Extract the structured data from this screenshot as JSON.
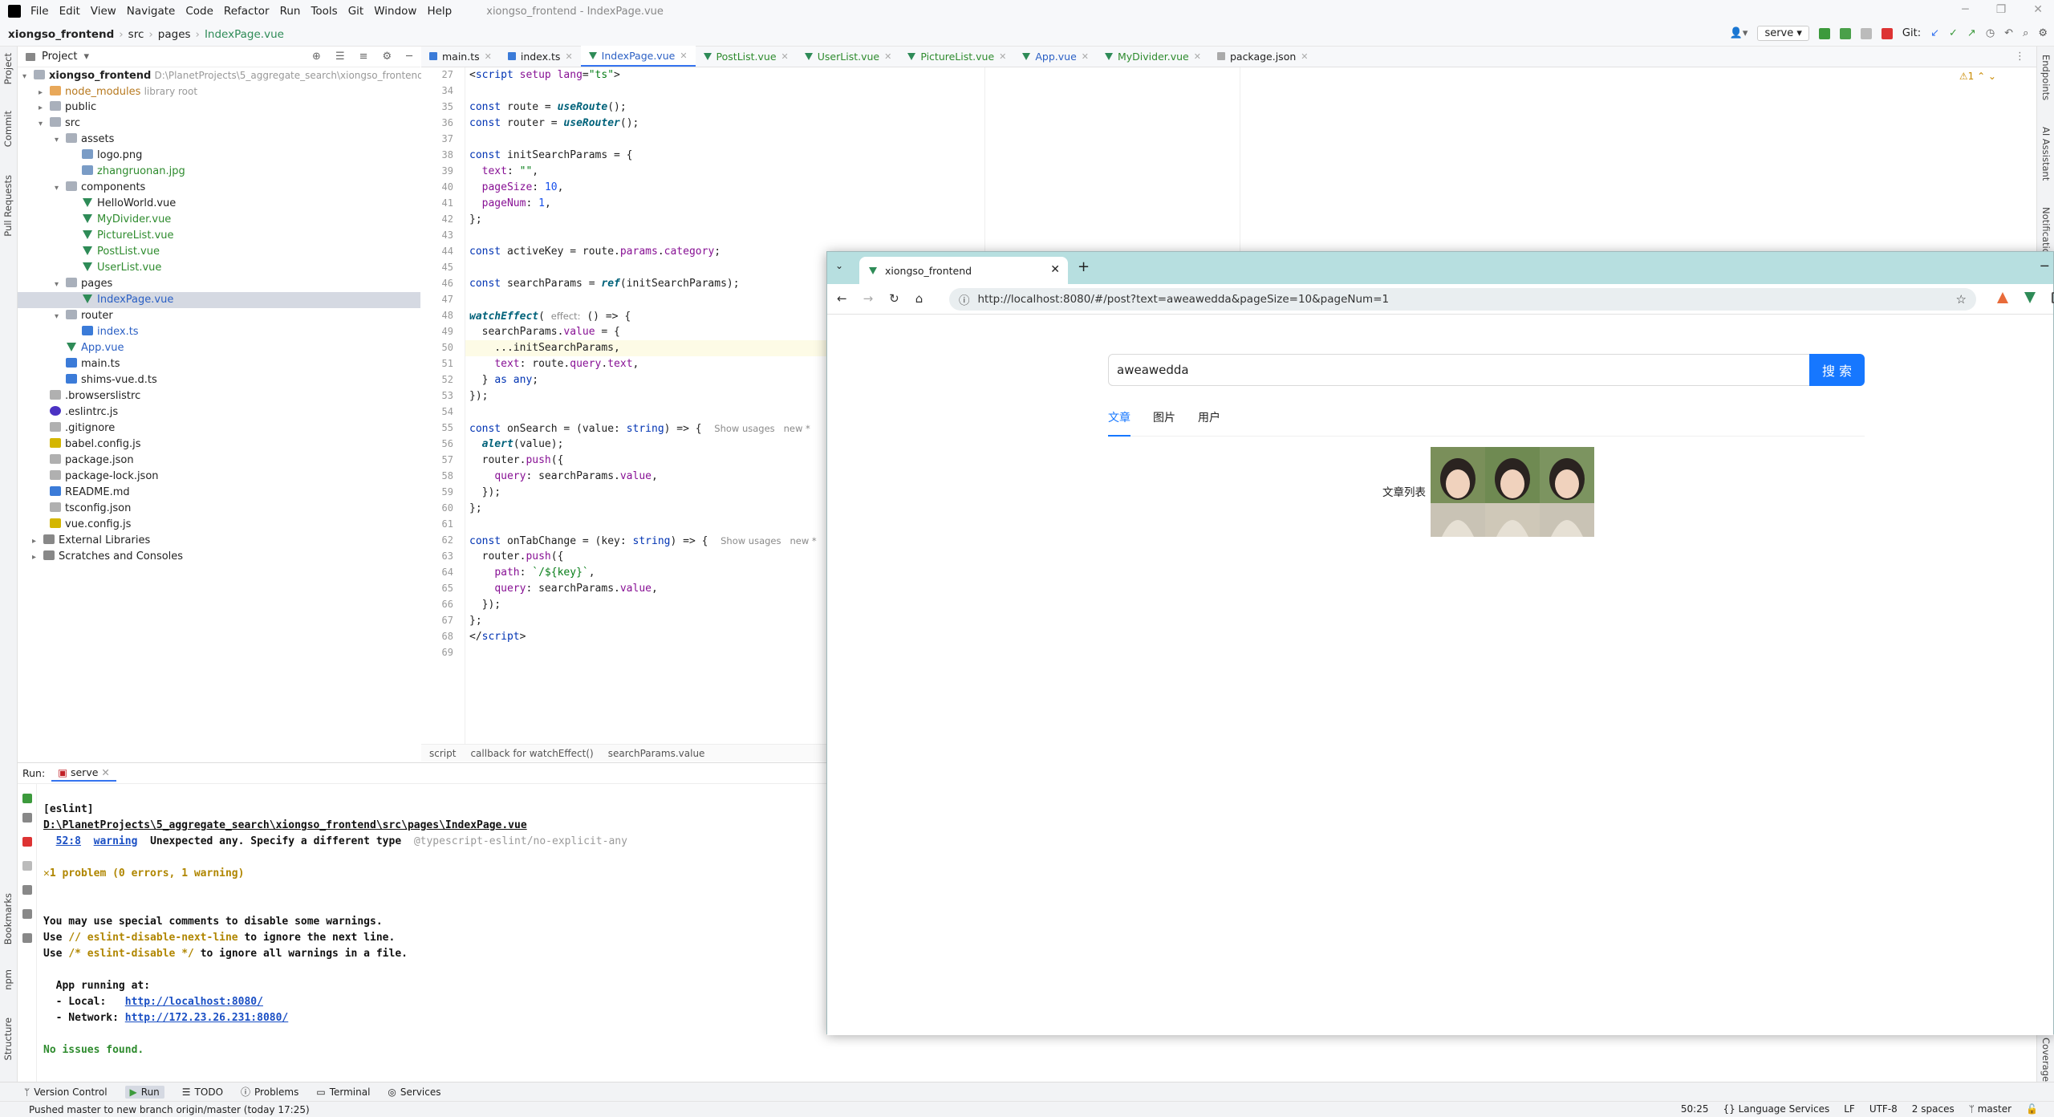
{
  "menubar": {
    "items": [
      "File",
      "Edit",
      "View",
      "Navigate",
      "Code",
      "Refactor",
      "Run",
      "Tools",
      "Git",
      "Window",
      "Help"
    ],
    "window_title": "xiongso_frontend - IndexPage.vue"
  },
  "navbar": {
    "project": "xiongso_frontend",
    "path": [
      "src",
      "pages"
    ],
    "file": "IndexPage.vue",
    "run_config": "serve",
    "git_label": "Git:"
  },
  "project_panel": {
    "title": "Project",
    "rows": [
      {
        "label": "xiongso_frontend",
        "extra": "D:\\PlanetProjects\\5_aggregate_search\\xiongso_frontend"
      },
      {
        "label": "node_modules",
        "extra": "library root"
      },
      {
        "label": "public",
        "extra": ""
      },
      {
        "label": "src",
        "extra": ""
      },
      {
        "label": "assets",
        "extra": ""
      },
      {
        "label": "logo.png",
        "extra": ""
      },
      {
        "label": "zhangruonan.jpg",
        "extra": ""
      },
      {
        "label": "components",
        "extra": ""
      },
      {
        "label": "HelloWorld.vue",
        "extra": ""
      },
      {
        "label": "MyDivider.vue",
        "extra": ""
      },
      {
        "label": "PictureList.vue",
        "extra": ""
      },
      {
        "label": "PostList.vue",
        "extra": ""
      },
      {
        "label": "UserList.vue",
        "extra": ""
      },
      {
        "label": "pages",
        "extra": ""
      },
      {
        "label": "IndexPage.vue",
        "extra": ""
      },
      {
        "label": "router",
        "extra": ""
      },
      {
        "label": "index.ts",
        "extra": ""
      },
      {
        "label": "App.vue",
        "extra": ""
      },
      {
        "label": "main.ts",
        "extra": ""
      },
      {
        "label": "shims-vue.d.ts",
        "extra": ""
      },
      {
        "label": ".browserslistrc",
        "extra": ""
      },
      {
        "label": ".eslintrc.js",
        "extra": ""
      },
      {
        "label": ".gitignore",
        "extra": ""
      },
      {
        "label": "babel.config.js",
        "extra": ""
      },
      {
        "label": "package.json",
        "extra": ""
      },
      {
        "label": "package-lock.json",
        "extra": ""
      },
      {
        "label": "README.md",
        "extra": ""
      },
      {
        "label": "tsconfig.json",
        "extra": ""
      },
      {
        "label": "vue.config.js",
        "extra": ""
      },
      {
        "label": "External Libraries",
        "extra": ""
      },
      {
        "label": "Scratches and Consoles",
        "extra": ""
      }
    ]
  },
  "editor_tabs": [
    "main.ts",
    "index.ts",
    "IndexPage.vue",
    "PostList.vue",
    "UserList.vue",
    "PictureList.vue",
    "App.vue",
    "MyDivider.vue",
    "package.json"
  ],
  "editor": {
    "line_numbers": [
      "27",
      "34",
      "35",
      "36",
      "37",
      "38",
      "39",
      "40",
      "41",
      "42",
      "43",
      "44",
      "45",
      "46",
      "47",
      "48",
      "49",
      "50",
      "51",
      "52",
      "53",
      "54",
      "55",
      "56",
      "57",
      "58",
      "59",
      "60",
      "61",
      "62",
      "63",
      "64",
      "65",
      "66",
      "67",
      "68",
      "69"
    ],
    "warning_count": "1",
    "breadcrumb": [
      "script",
      "callback for watchEffect()",
      "searchParams.value"
    ]
  },
  "run_panel": {
    "label": "Run:",
    "tab": "serve",
    "lines": [
      "[eslint]",
      "D:\\PlanetProjects\\5_aggregate_search\\xiongso_frontend\\src\\pages\\IndexPage.vue",
      "52:8",
      "warning",
      "Unexpected any. Specify a different type",
      "@typescript-eslint/no-explicit-any",
      "1 problem (0 errors, 1 warning)",
      "You may use special comments to disable some warnings.",
      "Use",
      "// eslint-disable-next-line",
      "to ignore the next line.",
      "Use",
      "/* eslint-disable */",
      "to ignore all warnings in a file.",
      "App running at:",
      "- Local:",
      "http://localhost:8080/",
      "- Network:",
      "http://172.23.26.231:8080/",
      "No issues found."
    ]
  },
  "bottom_tools": [
    "Version Control",
    "Run",
    "TODO",
    "Problems",
    "Terminal",
    "Services"
  ],
  "status": {
    "message": "Pushed master to new branch origin/master (today 17:25)",
    "position": "50:25",
    "lang": "Language Services",
    "lf": "LF",
    "encoding": "UTF-8",
    "indent": "2 spaces",
    "branch": "master"
  },
  "side_tabs": {
    "left": [
      "Project",
      "Commit",
      "Pull Requests",
      "Bookmarks",
      "npm",
      "Structure"
    ],
    "right": [
      "Endpoints",
      "AI Assistant",
      "Notifications",
      "Coverage"
    ]
  },
  "browser": {
    "tab_title": "xiongso_frontend",
    "url": "http://localhost:8080/#/post?text=aweawedda&pageSize=10&pageNum=1",
    "search_value": "aweawedda",
    "search_button": "搜 索",
    "tabs": [
      "文章",
      "图片",
      "用户"
    ],
    "list_label": "文章列表"
  }
}
